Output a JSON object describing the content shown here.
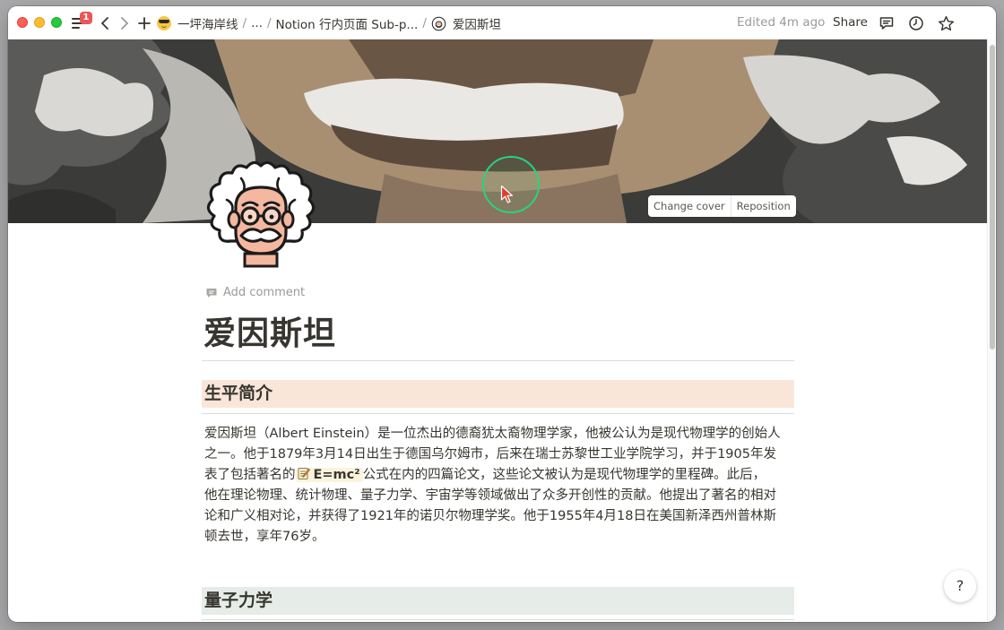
{
  "topbar": {
    "notification_count": "1",
    "breadcrumbs": [
      {
        "label": "一坪海岸线"
      },
      {
        "label": "..."
      },
      {
        "label": "Notion 行内页面 Sub-p..."
      },
      {
        "label": "爱因斯坦"
      }
    ],
    "edited": "Edited 4m ago",
    "share": "Share"
  },
  "cover": {
    "change_cover": "Change cover",
    "reposition": "Reposition"
  },
  "page": {
    "add_comment": "Add comment",
    "title": "爱因斯坦",
    "sections": [
      {
        "heading": "生平简介",
        "paragraph_lines": [
          "爱因斯坦（Albert Einstein）是一位杰出的德裔犹太裔物理学家，他被公认为是现代物理学的创始人",
          "之一。他于1879年3月14日出生于德国乌尔姆市，后来在瑞士苏黎世工业学院学习，并于1905年发",
          "表了包括著名的",
          "公式在内的四篇论文，这些论文被认为是现代物理学的里程碑。此后，",
          "他在理论物理、统计物理、量子力学、宇宙学等领域做出了众多开创性的贡献。他提出了著名的相对",
          "论和广义相对论，并获得了1921年的诺贝尔物理学奖。他于1955年4月18日在美国新泽西州普林斯",
          "顿去世，享年76岁。"
        ],
        "inline_page": "E=mc²"
      },
      {
        "heading": "量子力学"
      }
    ],
    "help": "?"
  },
  "colors": {
    "heading_orange_bg": "#fae6d9",
    "heading_green_bg": "#e6ece7",
    "inline_ref_bg": "#fbf3db",
    "cursor_ring": "#27d47f",
    "badge": "#eb5757"
  },
  "icons": [
    "menu-icon",
    "back-icon",
    "forward-icon",
    "new-page-icon",
    "comments-icon",
    "updates-clock-icon",
    "favorite-star-icon",
    "help-icon",
    "comment-icon",
    "memo-icon",
    "einstein-page-icon"
  ]
}
